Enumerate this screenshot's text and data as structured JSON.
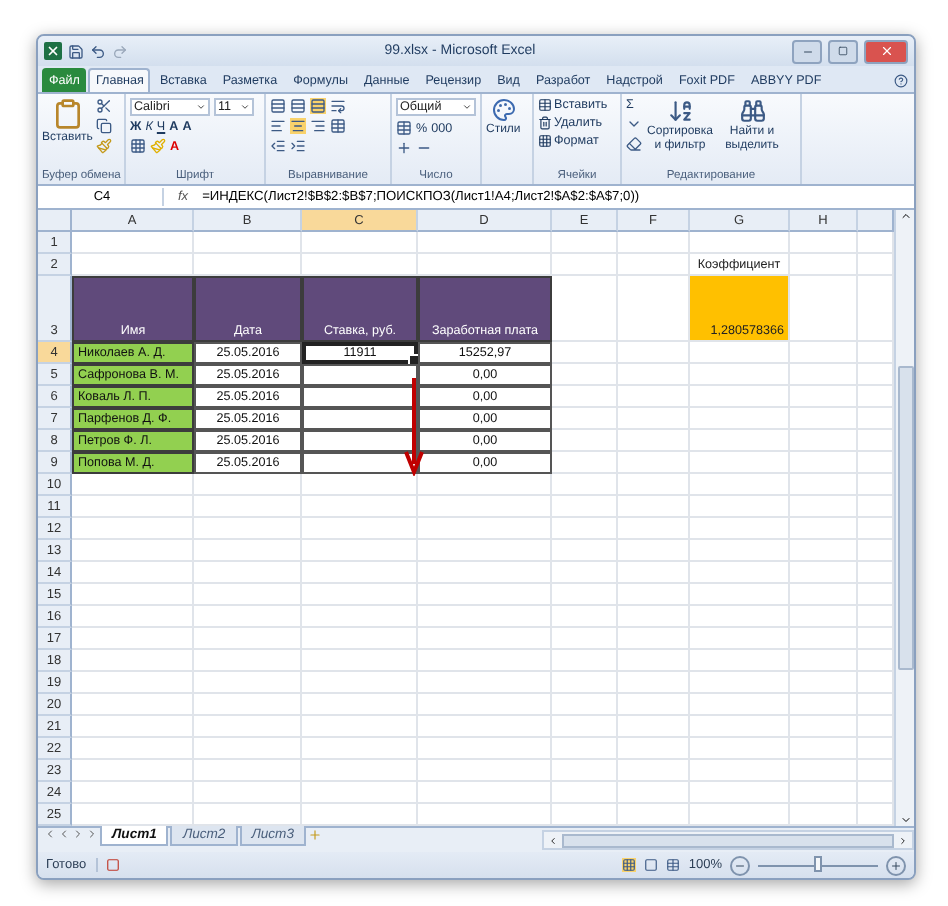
{
  "window": {
    "title": "99.xlsx - Microsoft Excel"
  },
  "ribbon": {
    "tabs": [
      {
        "label": "Файл",
        "kind": "file",
        "selected": false
      },
      {
        "label": "Главная",
        "kind": "tab",
        "selected": true
      },
      {
        "label": "Вставка",
        "kind": "tab",
        "selected": false
      },
      {
        "label": "Разметка",
        "kind": "tab",
        "selected": false
      },
      {
        "label": "Формулы",
        "kind": "tab",
        "selected": false
      },
      {
        "label": "Данные",
        "kind": "tab",
        "selected": false
      },
      {
        "label": "Рецензир",
        "kind": "tab",
        "selected": false
      },
      {
        "label": "Вид",
        "kind": "tab",
        "selected": false
      },
      {
        "label": "Разработ",
        "kind": "tab",
        "selected": false
      },
      {
        "label": "Надстрой",
        "kind": "tab",
        "selected": false
      },
      {
        "label": "Foxit PDF",
        "kind": "tab",
        "selected": false
      },
      {
        "label": "ABBYY PDF",
        "kind": "tab",
        "selected": false
      }
    ],
    "groups": [
      {
        "kind": "clipboard",
        "label": "Буфер обмена",
        "paste": "Вставить"
      },
      {
        "kind": "font",
        "label": "Шрифт",
        "font": "Calibri",
        "size": "11",
        "styles": [
          "Ж",
          "К",
          "Ч"
        ],
        "size_buttons": [
          "A",
          "A"
        ],
        "color_button": "A"
      },
      {
        "kind": "alignment",
        "label": "Выравнивание"
      },
      {
        "kind": "number",
        "label": "Число",
        "format": "Общий",
        "symbols": [
          "%",
          "000"
        ]
      },
      {
        "kind": "styles",
        "button": "Стили"
      },
      {
        "kind": "cells",
        "label": "Ячейки",
        "buttons": [
          "Вставить",
          "Удалить",
          "Формат"
        ]
      },
      {
        "kind": "editing",
        "label": "Редактирование",
        "sum": "Σ",
        "buttons": [
          "Сортировка и фильтр",
          "Найти и выделить"
        ]
      }
    ]
  },
  "formula_bar": {
    "name_box": "C4",
    "fx": "fx",
    "formula": "=ИНДЕКС(Лист2!$B$2:$B$7;ПОИСКПОЗ(Лист1!A4;Лист2!$A$2:$A$7;0))"
  },
  "sheet": {
    "columns": [
      {
        "label": "A",
        "selected": false
      },
      {
        "label": "B",
        "selected": false
      },
      {
        "label": "C",
        "selected": true
      },
      {
        "label": "D",
        "selected": false
      },
      {
        "label": "E",
        "selected": false
      },
      {
        "label": "F",
        "selected": false
      },
      {
        "label": "G",
        "selected": false
      },
      {
        "label": "H",
        "selected": false
      }
    ],
    "rows": [
      {
        "number": "1",
        "selected": false
      },
      {
        "number": "2",
        "selected": false,
        "cells": [
          {
            "kind": "empty"
          },
          {
            "kind": "empty"
          },
          {
            "kind": "empty"
          },
          {
            "kind": "empty"
          },
          {
            "kind": "empty"
          },
          {
            "kind": "empty"
          },
          {
            "kind": "label",
            "text": "Коэффициент"
          }
        ]
      },
      {
        "number": "3",
        "selected": false,
        "cells": [
          {
            "kind": "header",
            "text": "Имя"
          },
          {
            "kind": "header",
            "text": "Дата"
          },
          {
            "kind": "header",
            "text": "Ставка, руб."
          },
          {
            "kind": "header",
            "text": "Заработная плата"
          },
          {
            "kind": "empty"
          },
          {
            "kind": "empty"
          },
          {
            "kind": "coef",
            "text": "1,280578366"
          }
        ]
      },
      {
        "number": "4",
        "selected": true,
        "cells": [
          {
            "kind": "name",
            "text": "Николаев А. Д."
          },
          {
            "kind": "value",
            "text": "25.05.2016"
          },
          {
            "kind": "value",
            "text": "11911",
            "selected": true
          },
          {
            "kind": "value",
            "text": "15252,97"
          }
        ]
      },
      {
        "number": "5",
        "selected": false,
        "cells": [
          {
            "kind": "name",
            "text": "Сафронова В. М."
          },
          {
            "kind": "value",
            "text": "25.05.2016"
          },
          {
            "kind": "value"
          },
          {
            "kind": "value",
            "text": "0,00"
          }
        ]
      },
      {
        "number": "6",
        "selected": false,
        "cells": [
          {
            "kind": "name",
            "text": "Коваль Л. П."
          },
          {
            "kind": "value",
            "text": "25.05.2016"
          },
          {
            "kind": "value"
          },
          {
            "kind": "value",
            "text": "0,00"
          }
        ]
      },
      {
        "number": "7",
        "selected": false,
        "cells": [
          {
            "kind": "name",
            "text": "Парфенов Д. Ф."
          },
          {
            "kind": "value",
            "text": "25.05.2016"
          },
          {
            "kind": "value"
          },
          {
            "kind": "value",
            "text": "0,00"
          }
        ]
      },
      {
        "number": "8",
        "selected": false,
        "cells": [
          {
            "kind": "name",
            "text": "Петров Ф. Л."
          },
          {
            "kind": "value",
            "text": "25.05.2016"
          },
          {
            "kind": "value"
          },
          {
            "kind": "value",
            "text": "0,00"
          }
        ]
      },
      {
        "number": "9",
        "selected": false,
        "cells": [
          {
            "kind": "name",
            "text": "Попова М. Д."
          },
          {
            "kind": "value",
            "text": "25.05.2016"
          },
          {
            "kind": "value"
          },
          {
            "kind": "value",
            "text": "0,00"
          }
        ]
      },
      {
        "number": "10",
        "selected": false
      },
      {
        "number": "11",
        "selected": false
      },
      {
        "number": "12",
        "selected": false
      },
      {
        "number": "13",
        "selected": false
      },
      {
        "number": "14",
        "selected": false
      },
      {
        "number": "15",
        "selected": false
      },
      {
        "number": "16",
        "selected": false
      },
      {
        "number": "17",
        "selected": false
      },
      {
        "number": "18",
        "selected": false
      },
      {
        "number": "19",
        "selected": false
      },
      {
        "number": "20",
        "selected": false
      },
      {
        "number": "21",
        "selected": false
      },
      {
        "number": "22",
        "selected": false
      },
      {
        "number": "23",
        "selected": false
      },
      {
        "number": "24",
        "selected": false
      },
      {
        "number": "25",
        "selected": false
      }
    ]
  },
  "sheet_tabs": [
    {
      "label": "Лист1",
      "selected": true
    },
    {
      "label": "Лист2",
      "selected": false
    },
    {
      "label": "Лист3",
      "selected": false
    }
  ],
  "status_bar": {
    "text": "Готово",
    "zoom": "100%",
    "level": 0.5
  }
}
